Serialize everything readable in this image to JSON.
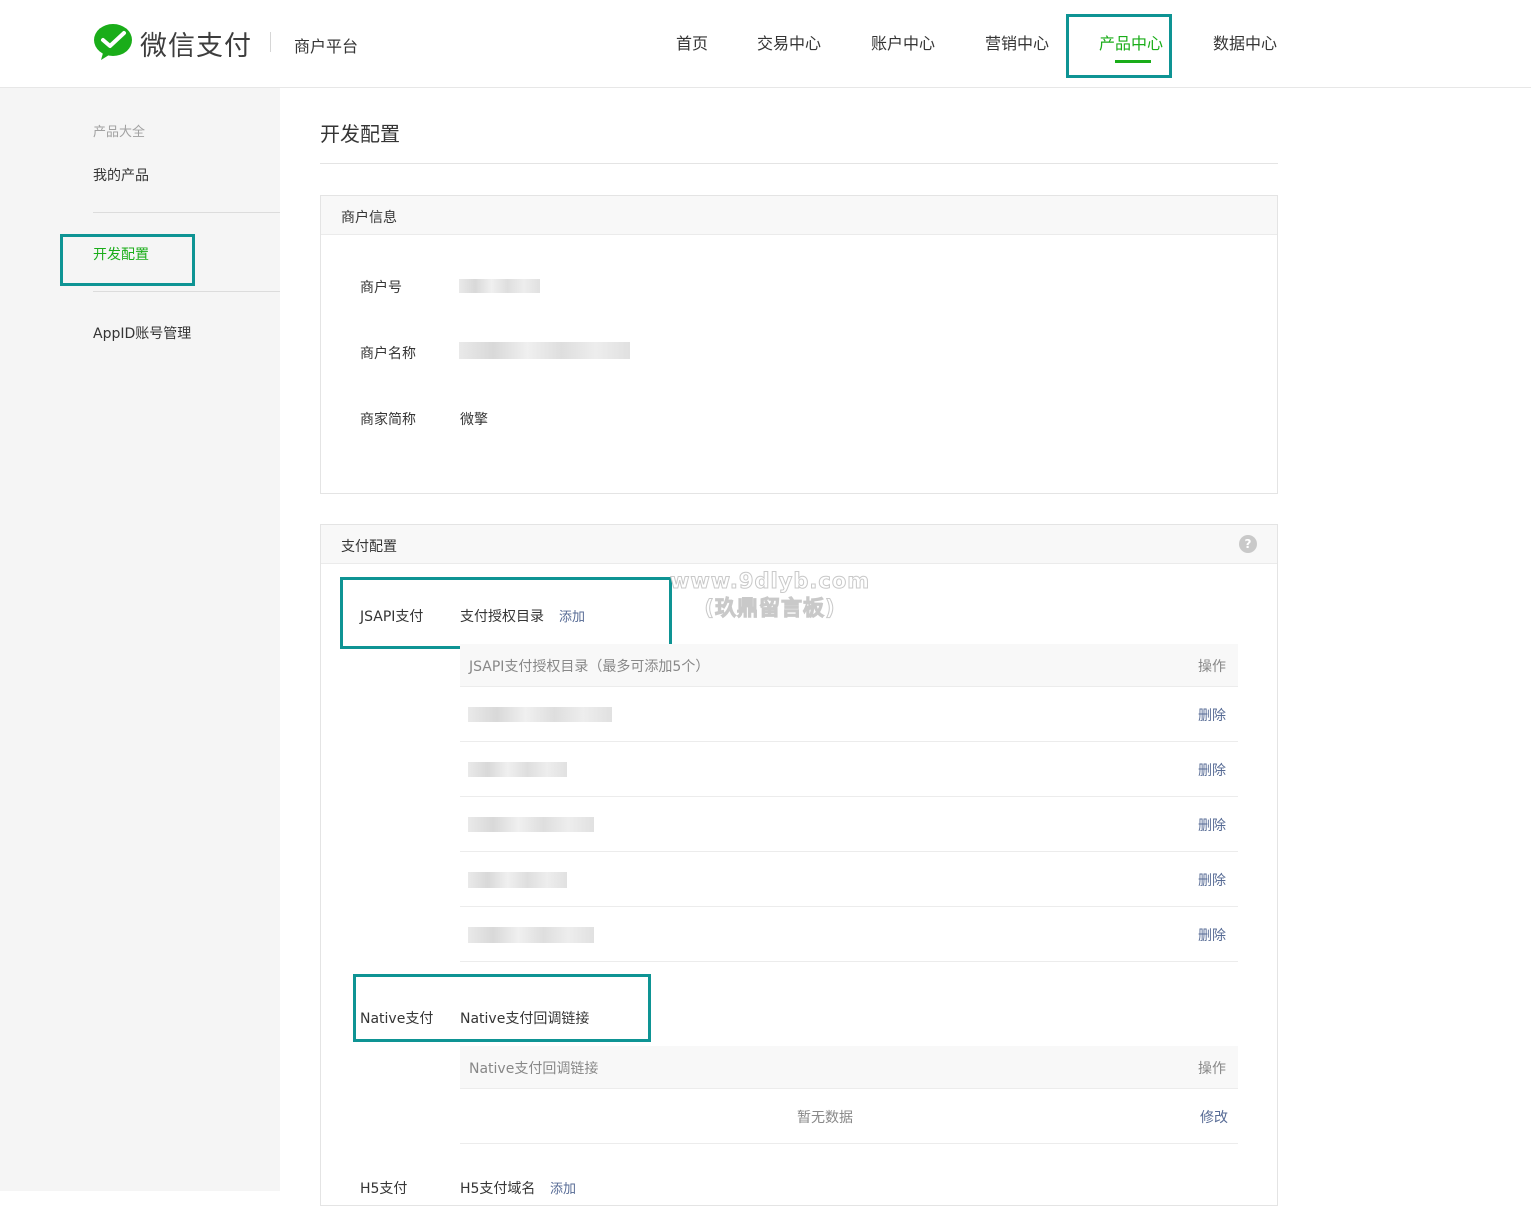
{
  "header": {
    "brand": "微信支付",
    "platform": "商户平台",
    "nav": [
      {
        "label": "首页",
        "active": false
      },
      {
        "label": "交易中心",
        "active": false
      },
      {
        "label": "账户中心",
        "active": false
      },
      {
        "label": "营销中心",
        "active": false
      },
      {
        "label": "产品中心",
        "active": true
      },
      {
        "label": "数据中心",
        "active": false
      }
    ]
  },
  "sidebar": {
    "items": [
      {
        "label": "产品大全",
        "kind": "category"
      },
      {
        "label": "我的产品",
        "kind": "link"
      },
      {
        "label": "开发配置",
        "kind": "link",
        "active": true
      },
      {
        "label": "AppID账号管理",
        "kind": "link"
      }
    ]
  },
  "page": {
    "title": "开发配置"
  },
  "merchant_info": {
    "title": "商户信息",
    "fields": [
      {
        "label": "商户号",
        "value": ""
      },
      {
        "label": "商户名称",
        "value": ""
      },
      {
        "label": "商家简称",
        "value": "微擎"
      }
    ]
  },
  "pay_config": {
    "title": "支付配置",
    "help_icon": "?",
    "jsapi": {
      "name": "JSAPI支付",
      "field": "支付授权目录",
      "action": "添加",
      "table_header": "JSAPI支付授权目录（最多可添加5个）",
      "op_header": "操作",
      "rows": [
        {
          "op": "删除"
        },
        {
          "op": "删除"
        },
        {
          "op": "删除"
        },
        {
          "op": "删除"
        },
        {
          "op": "删除"
        }
      ]
    },
    "native": {
      "name": "Native支付",
      "field": "Native支付回调链接",
      "table_header": "Native支付回调链接",
      "op_header": "操作",
      "empty_text": "暂无数据",
      "op": "修改"
    },
    "h5": {
      "name": "H5支付",
      "field": "H5支付域名",
      "action": "添加"
    }
  },
  "watermark": {
    "line1": "www.9dlyb.com",
    "line2": "(玖鼎留言板)"
  },
  "colors": {
    "brand_green": "#1aad19",
    "link_blue": "#576b95",
    "highlight_teal": "#0e9494"
  }
}
